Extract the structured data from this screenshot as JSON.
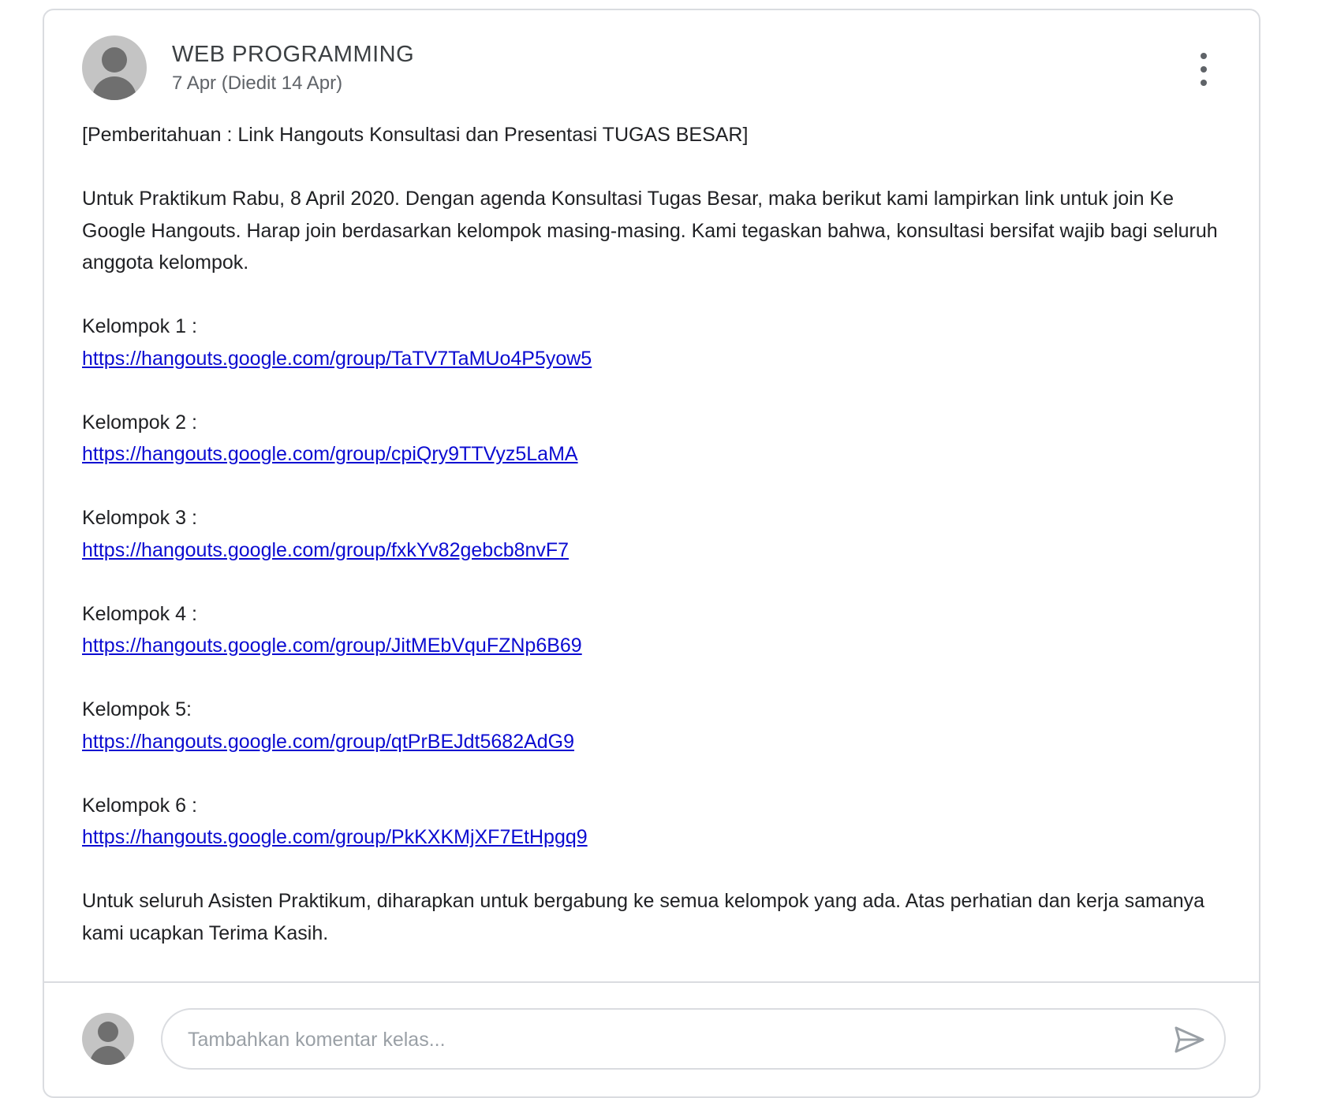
{
  "post": {
    "author": "WEB PROGRAMMING",
    "date": "7 Apr (Diedit 14 Apr)",
    "title_line": "[Pemberitahuan : Link Hangouts Konsultasi dan Presentasi TUGAS BESAR]",
    "intro": "Untuk Praktikum Rabu, 8 April 2020. Dengan agenda Konsultasi Tugas Besar, maka berikut kami lampirkan link untuk join Ke Google Hangouts. Harap join berdasarkan kelompok masing-masing. Kami tegaskan bahwa, konsultasi bersifat wajib bagi seluruh anggota kelompok.",
    "groups": [
      {
        "label": "Kelompok 1 :",
        "link": "https://hangouts.google.com/group/TaTV7TaMUo4P5yow5"
      },
      {
        "label": "Kelompok 2 :",
        "link": "https://hangouts.google.com/group/cpiQry9TTVyz5LaMA"
      },
      {
        "label": "Kelompok 3 :",
        "link": "https://hangouts.google.com/group/fxkYv82gebcb8nvF7"
      },
      {
        "label": "Kelompok 4 :",
        "link": "https://hangouts.google.com/group/JitMEbVquFZNp6B69"
      },
      {
        "label": "Kelompok 5:",
        "link": "https://hangouts.google.com/group/qtPrBEJdt5682AdG9"
      },
      {
        "label": "Kelompok 6 :",
        "link": "https://hangouts.google.com/group/PkKXKMjXF7EtHpgq9"
      }
    ],
    "closing": "Untuk seluruh Asisten Praktikum, diharapkan untuk bergabung ke semua kelompok yang ada. Atas perhatian dan kerja samanya kami ucapkan Terima Kasih."
  },
  "comment": {
    "placeholder": "Tambahkan komentar kelas..."
  },
  "icons": {
    "avatar": "account-circle-icon",
    "more": "more-vert-icon",
    "send": "send-icon"
  },
  "colors": {
    "link": "#0b0bd1",
    "border": "#dadce0",
    "avatar_bg": "#c4c4c4",
    "avatar_fg": "#6f6f6f"
  }
}
